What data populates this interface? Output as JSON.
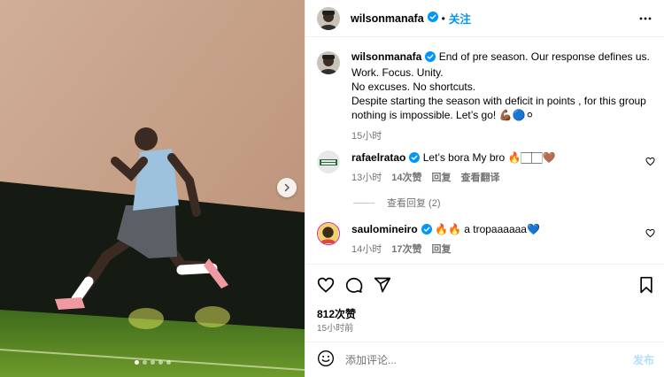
{
  "post": {
    "author": "wilsonmanafa",
    "follow_label": "关注",
    "separator": "•",
    "caption": "End of pre season. Our response defines us.\nWork. Focus. Unity.\nNo excuses. No shortcuts.\nDespite starting the season with deficit in points , for this group nothing is impossible. Let’s go! 💪🏾🔵⚪",
    "caption_time": "15小时",
    "likes": "812次赞",
    "time": "15小时前",
    "carousel": {
      "total": 5,
      "active": 1
    }
  },
  "comments": [
    {
      "user": "rafaelratao",
      "text": "Let’s bora My bro 🔥🏻🏻🤎",
      "time": "13小时",
      "likes": "14次赞",
      "reply": "回复",
      "translate": "查看翻译"
    },
    {
      "user": "saulomineiro",
      "text": "🔥🔥 a tropaaaaaa💙",
      "time": "14小时",
      "likes": "17次赞",
      "reply": "回复"
    }
  ],
  "view_replies": "查看回复 (2)",
  "comment_box": {
    "placeholder": "添加评论...",
    "post_label": "发布"
  },
  "icons": {
    "verified": "verified-badge-icon",
    "more": "more-horizontal-icon",
    "next": "chevron-right-icon",
    "like": "heart-icon",
    "comment": "comment-bubble-icon",
    "share": "paper-plane-icon",
    "save": "bookmark-icon",
    "emoji": "smiley-icon"
  },
  "colors": {
    "accent": "#0095f6",
    "muted": "#737373",
    "verified": "#0095f6"
  }
}
